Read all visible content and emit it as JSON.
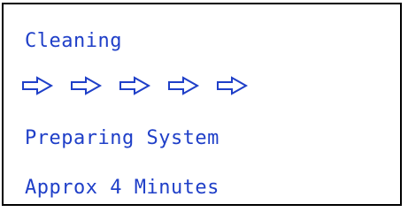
{
  "display": {
    "title": "Cleaning",
    "status": "Preparing System",
    "time_estimate": "Approx 4 Minutes",
    "progress_icons": [
      "arrow-right-icon",
      "arrow-right-icon",
      "arrow-right-icon",
      "arrow-right-icon",
      "arrow-right-icon"
    ],
    "text_color": "#1f3fc8",
    "border_color": "#000000",
    "background_color": "#ffffff"
  }
}
